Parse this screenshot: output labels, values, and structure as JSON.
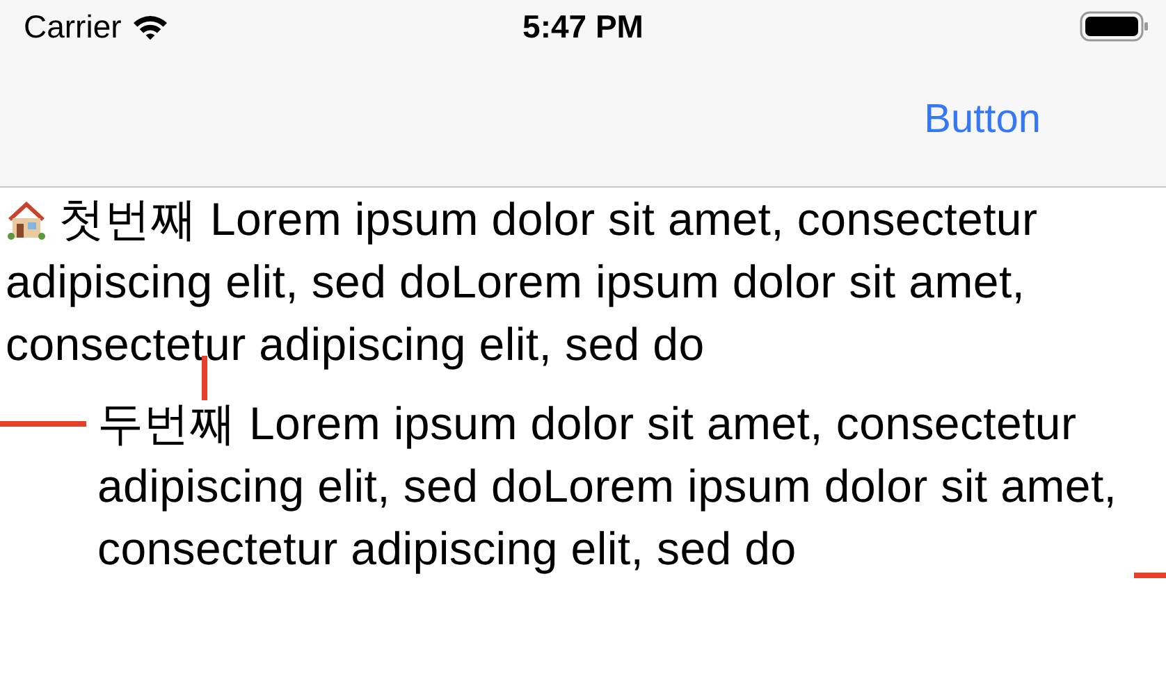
{
  "status_bar": {
    "carrier": "Carrier",
    "time": "5:47 PM"
  },
  "nav_bar": {
    "button": "Button"
  },
  "paragraphs": [
    {
      "kind": "icon",
      "text": "첫번째 Lorem ipsum dolor sit amet, consectetur adipiscing elit, sed doLorem ipsum dolor sit amet, consectetur adipiscing elit, sed do"
    },
    {
      "kind": "indented",
      "text": "두번째 Lorem ipsum dolor sit amet, consectetur adipiscing elit, sed doLorem ipsum dolor sit amet, consectetur adipiscing elit, sed do"
    }
  ]
}
